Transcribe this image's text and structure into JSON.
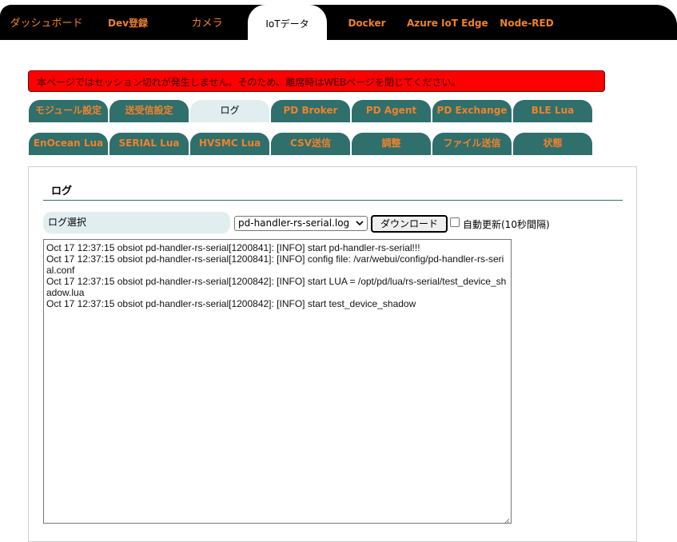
{
  "topnav": {
    "tabs": [
      {
        "label": "ダッシュボード"
      },
      {
        "label": "Dev登録"
      },
      {
        "label": "カメラ"
      },
      {
        "label": "IoTデータ"
      },
      {
        "label": "Docker"
      },
      {
        "label": "Azure IoT Edge"
      },
      {
        "label": "Node-RED"
      }
    ]
  },
  "warning": {
    "text": "本ページではセッション切れが発生しません。そのため、離席時はWEBページを閉じてください。"
  },
  "subtabs": [
    {
      "label": "モジュール設定"
    },
    {
      "label": "送受信設定"
    },
    {
      "label": "ログ"
    },
    {
      "label": "PD Broker"
    },
    {
      "label": "PD Agent"
    },
    {
      "label": "PD Exchange"
    },
    {
      "label": "BLE Lua"
    },
    {
      "label": "EnOcean Lua"
    },
    {
      "label": "SERIAL Lua"
    },
    {
      "label": "HVSMC Lua"
    },
    {
      "label": "CSV送信"
    },
    {
      "label": "調整"
    },
    {
      "label": "ファイル送信"
    },
    {
      "label": "状態"
    }
  ],
  "panel": {
    "title": "ログ",
    "log_select_label": "ログ選択",
    "selected_log": "pd-handler-rs-serial.log",
    "download_label": "ダウンロード",
    "auto_refresh_label": "自動更新(10秒間隔)",
    "auto_refresh_checked": false,
    "log_lines": [
      "Oct 17 12:37:15 obsiot pd-handler-rs-serial[1200841]: [INFO] start pd-handler-rs-serial!!!",
      "Oct 17 12:37:15 obsiot pd-handler-rs-serial[1200841]: [INFO] config file: /var/webui/config/pd-handler-rs-serial.conf",
      "Oct 17 12:37:15 obsiot pd-handler-rs-serial[1200842]: [INFO] start LUA = /opt/pd/lua/rs-serial/test_device_shadow.lua",
      "Oct 17 12:37:15 obsiot pd-handler-rs-serial[1200842]: [INFO] start test_device_shadow"
    ]
  },
  "colors": {
    "nav_bg": "#000000",
    "nav_text": "#f0822a",
    "tab_bg": "#2f6f6c",
    "tab_active_bg": "#e1eef0",
    "warning_bg": "#ff0000"
  }
}
